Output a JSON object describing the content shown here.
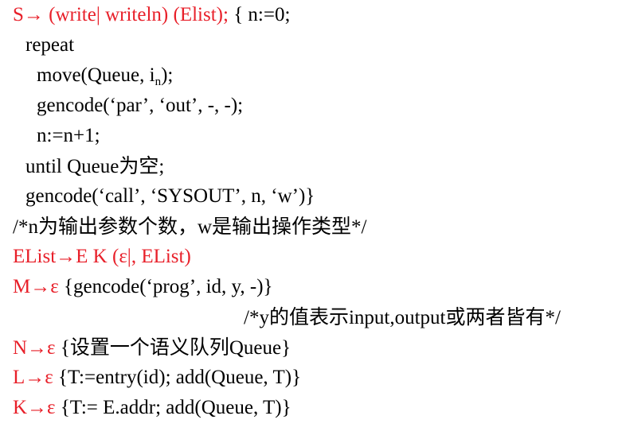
{
  "lines": {
    "l1": {
      "head": "S→ (write| writeln) (Elist);",
      "body": " { n:=0;"
    },
    "l2": {
      "body": "repeat"
    },
    "l3": {
      "pre": "move(Queue, i",
      "sub": "n",
      "post": ");"
    },
    "l4": {
      "body": "gencode(‘par’, ‘out’, -, -);"
    },
    "l5": {
      "body": "n:=n+1;"
    },
    "l6": {
      "body": "until Queue",
      "cjk": "为空",
      "post": ";"
    },
    "l7": {
      "body": "gencode(‘call’, ‘SYSOUT’, n, ‘w’)}"
    },
    "l8": {
      "a": "/*n",
      "b": "为输出参数个数，",
      "c": "w",
      "d": "是输出操作类型",
      "e": "*/"
    },
    "l9": {
      "head": "EList→E K (ε|, EList)"
    },
    "l10": {
      "head": "M→ε",
      "body": " {gencode(‘prog’, id, y, -)}"
    },
    "l11": {
      "a": "/*y",
      "b": "的值表示",
      "c": "input,output",
      "d": "或两者皆有",
      "e": "*/"
    },
    "l12": {
      "head": "N→ε",
      "body": " {",
      "cjk": "设置一个语义队列",
      "post": "Queue}"
    },
    "l13": {
      "head": "L→ε",
      "body": " {T:=entry(id); add(Queue, T)}"
    },
    "l14": {
      "head": "K→ε",
      "body": " {T:= E.addr; add(Queue, T)}"
    }
  },
  "colors": {
    "production_head": "#e8202a",
    "text": "#000000"
  }
}
